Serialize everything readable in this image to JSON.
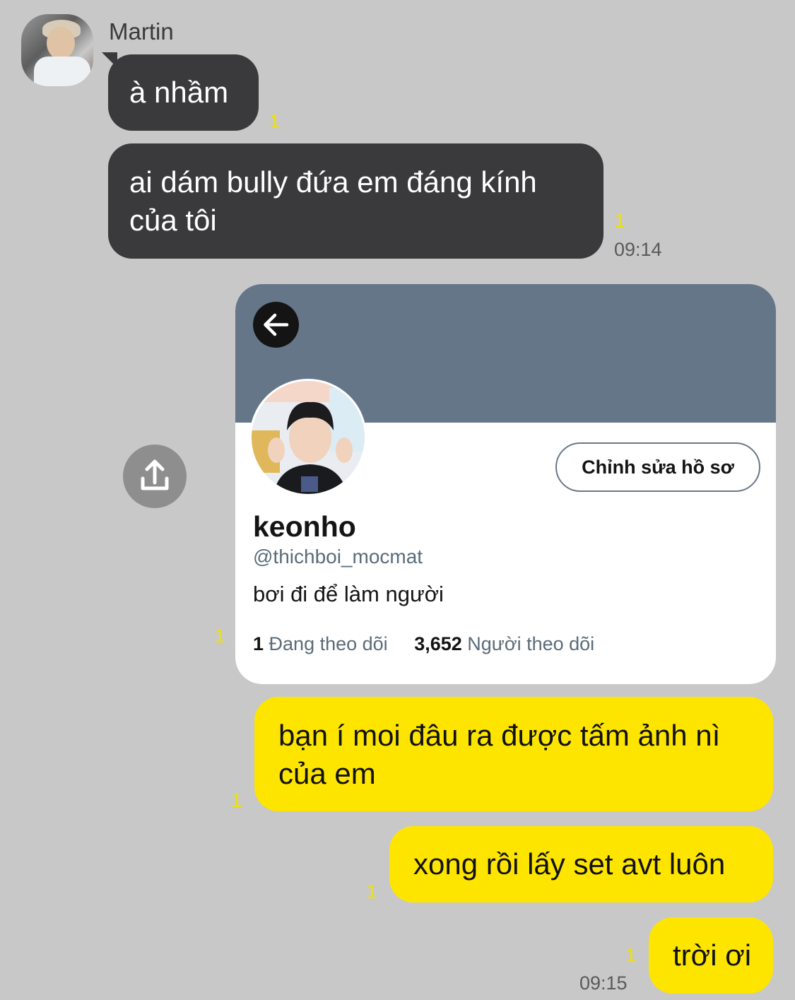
{
  "chat": {
    "sender_name": "Martin",
    "messages": [
      {
        "side": "left",
        "text": "à nhầm",
        "unread": "1"
      },
      {
        "side": "left",
        "text_line1": "ai dám bully đứa em đáng kính",
        "text_line2": "của tôi",
        "unread": "1",
        "time": "09:14"
      },
      {
        "side": "right",
        "type": "image",
        "unread": "1"
      },
      {
        "side": "right",
        "text_line1": "bạn í moi đâu ra được tấm ảnh nì",
        "text_line2": "của em",
        "unread": "1"
      },
      {
        "side": "right",
        "text": "xong rồi lấy set avt luôn",
        "unread": "1"
      },
      {
        "side": "right",
        "text": "trời ơi",
        "unread": "1",
        "time": "09:15"
      }
    ]
  },
  "profile_card": {
    "edit_button": "Chỉnh sửa hồ sơ",
    "name": "keonho",
    "handle": "@thichboi_mocmat",
    "bio": "bơi đi để làm người",
    "following_count": "1",
    "following_label": "Đang theo dõi",
    "followers_count": "3,652",
    "followers_label": "Người theo dõi"
  },
  "icons": {
    "share": "share-icon",
    "back": "arrow-left-icon"
  },
  "colors": {
    "background": "#c8c8c8",
    "dark_bubble": "#3a3a3c",
    "yellow_bubble": "#fee500",
    "unread": "#f1e000",
    "banner": "#667689"
  }
}
